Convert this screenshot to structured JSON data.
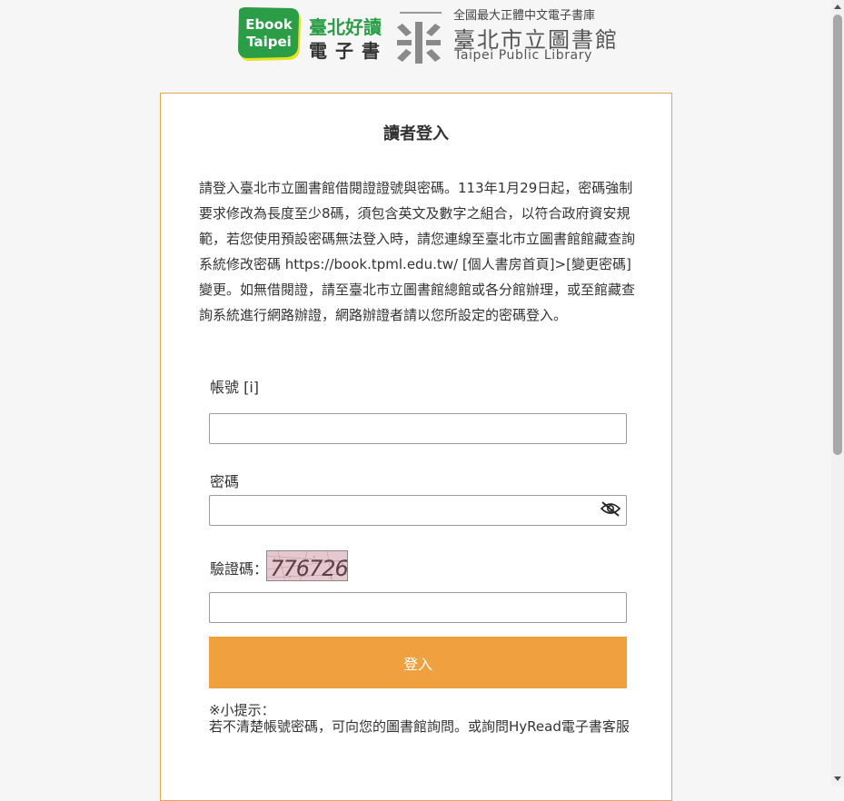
{
  "header": {
    "ebook_logo_line1": "Ebook",
    "ebook_logo_line2": "Taipei",
    "ebook_name_line1": "臺北好讀",
    "ebook_name_line2": "電子書",
    "library_tagline": "全國最大正體中文電子書庫",
    "library_name_cn": "臺北市立圖書館",
    "library_name_en": "Taipei Public Library"
  },
  "login": {
    "title": "讀者登入",
    "notice": "請登入臺北市立圖書館借閱證證號與密碼。113年1月29日起，密碼強制要求修改為長度至少8碼，須包含英文及數字之組合，以符合政府資安規範，若您使用預設密碼無法登入時，請您連線至臺北市立圖書館館藏查詢系統修改密碼 https://book.tpml.edu.tw/ [個人書房首頁]>[變更密碼]變更。如無借閱證，請至臺北市立圖書館總館或各分館辦理，或至館藏查詢系統進行網路辦證，網路辦證者請以您所設定的密碼登入。",
    "account_label": "帳號 [i]",
    "account_value": "",
    "password_label": "密碼",
    "password_value": "",
    "captcha_label": "驗證碼：",
    "captcha_code": "776726",
    "captcha_value": "",
    "submit_label": "登入",
    "tip_title": "※小提示：",
    "tip_body": "若不清楚帳號密碼，可向您的圖書館詢問。或詢問HyRead電子書客服"
  },
  "colors": {
    "accent": "#f0a03f",
    "card_border": "#e8a64f",
    "brand_green": "#2a9d46",
    "brand_yellow": "#e6e21d"
  },
  "icons": {
    "password_toggle": "eye-off-icon"
  }
}
